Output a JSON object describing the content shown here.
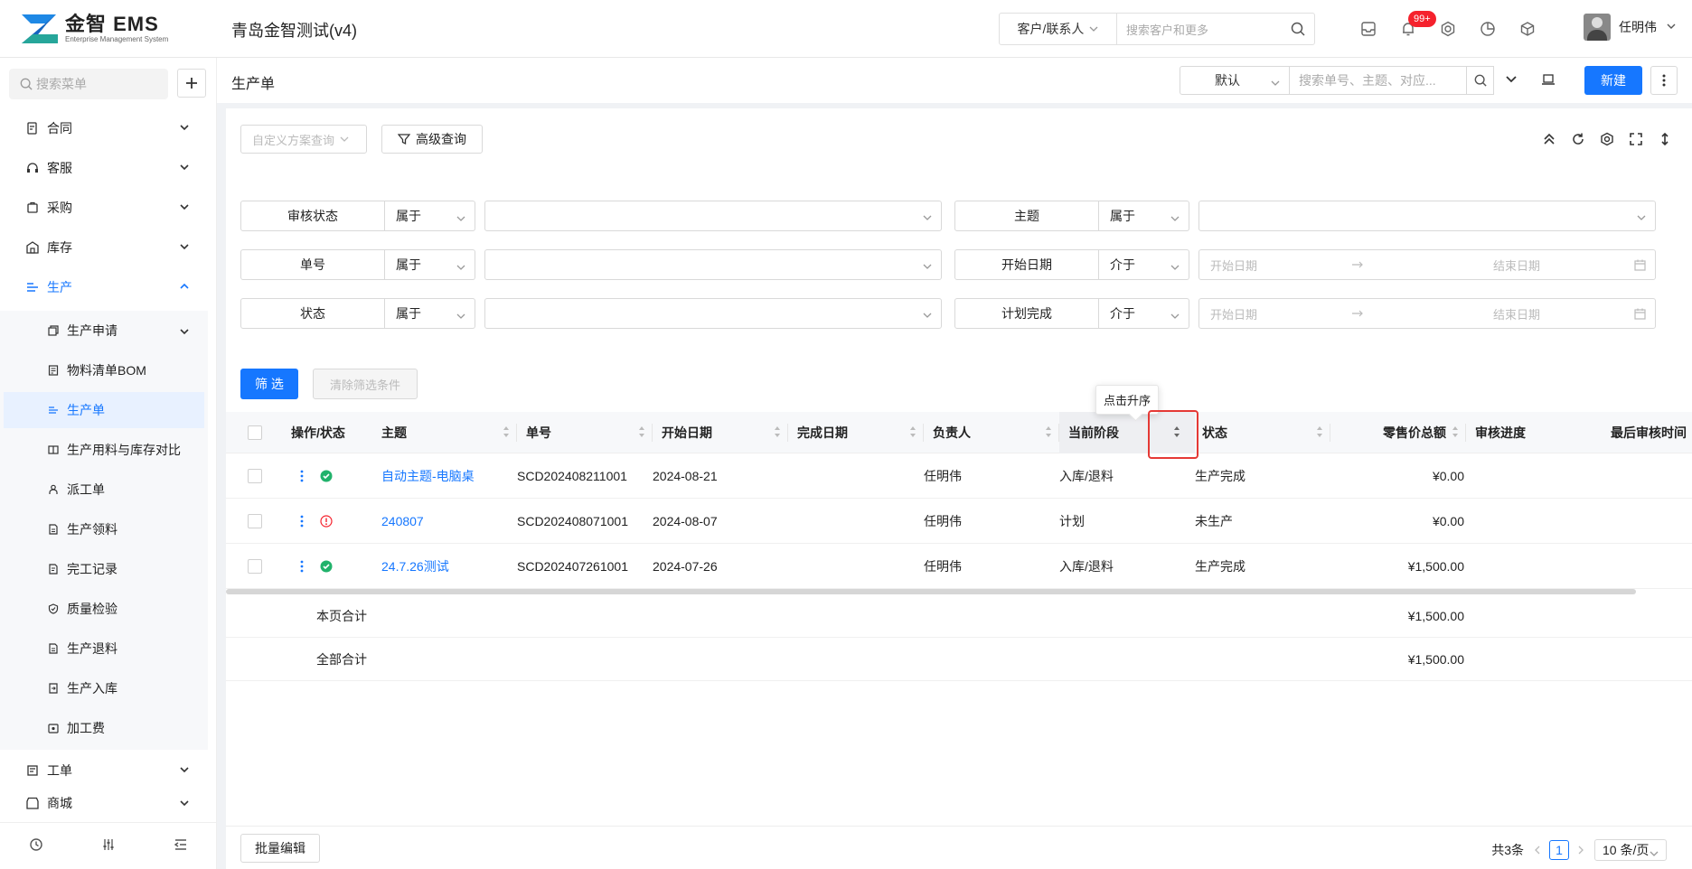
{
  "app": {
    "logo_text": "金智 EMS",
    "logo_sub": "Enterprise Management System",
    "title": "青岛金智测试(v4)"
  },
  "topbar": {
    "search_scope": "客户/联系人",
    "search_placeholder": "搜索客户和更多",
    "notification_badge": "99+",
    "user_name": "任明伟"
  },
  "sidebar": {
    "search_placeholder": "搜索菜单",
    "items": [
      {
        "label": "合同",
        "icon": "contract-icon"
      },
      {
        "label": "客服",
        "icon": "headset-icon"
      },
      {
        "label": "采购",
        "icon": "cart-icon"
      },
      {
        "label": "库存",
        "icon": "warehouse-icon"
      },
      {
        "label": "生产",
        "icon": "production-icon"
      },
      {
        "label": "工单",
        "icon": "workorder-icon"
      },
      {
        "label": "商城",
        "icon": "shop-icon"
      }
    ],
    "sub_items": [
      {
        "label": "生产申请"
      },
      {
        "label": "物料清单BOM"
      },
      {
        "label": "生产单"
      },
      {
        "label": "生产用料与库存对比"
      },
      {
        "label": "派工单"
      },
      {
        "label": "生产领料"
      },
      {
        "label": "完工记录"
      },
      {
        "label": "质量检验"
      },
      {
        "label": "生产退料"
      },
      {
        "label": "生产入库"
      },
      {
        "label": "加工费"
      }
    ]
  },
  "page": {
    "title": "生产单",
    "view_select": "默认",
    "search_placeholder": "搜索单号、主题、对应...",
    "new_button": "新建",
    "custom_query_placeholder": "自定义方案查询",
    "advanced_query": "高级查询"
  },
  "filters": [
    {
      "label": "审核状态",
      "op": "属于",
      "type": "select"
    },
    {
      "label": "主题",
      "op": "属于",
      "type": "select"
    },
    {
      "label": "单号",
      "op": "属于",
      "type": "select"
    },
    {
      "label": "开始日期",
      "op": "介于",
      "type": "date",
      "start_placeholder": "开始日期",
      "end_placeholder": "结束日期"
    },
    {
      "label": "状态",
      "op": "属于",
      "type": "select"
    },
    {
      "label": "计划完成",
      "op": "介于",
      "type": "date",
      "start_placeholder": "开始日期",
      "end_placeholder": "结束日期"
    }
  ],
  "filter_actions": {
    "apply": "筛 选",
    "clear": "清除筛选条件"
  },
  "table": {
    "columns": [
      "操作/状态",
      "主题",
      "单号",
      "开始日期",
      "完成日期",
      "负责人",
      "当前阶段",
      "状态",
      "零售价总额",
      "审核进度",
      "最后审核时间"
    ],
    "rows": [
      {
        "status": "ok",
        "subject": "自动主题-电脑桌",
        "no": "SCD202408211001",
        "start": "2024-08-21",
        "end": "",
        "owner": "任明伟",
        "stage": "入库/退料",
        "state": "生产完成",
        "amount": "¥0.00"
      },
      {
        "status": "warn",
        "subject": "240807",
        "no": "SCD202408071001",
        "start": "2024-08-07",
        "end": "",
        "owner": "任明伟",
        "stage": "计划",
        "state": "未生产",
        "amount": "¥0.00"
      },
      {
        "status": "ok",
        "subject": "24.7.26测试",
        "no": "SCD202407261001",
        "start": "2024-07-26",
        "end": "",
        "owner": "任明伟",
        "stage": "入库/退料",
        "state": "生产完成",
        "amount": "¥1,500.00"
      }
    ],
    "page_total_label": "本页合计",
    "page_total": "¥1,500.00",
    "all_total_label": "全部合计",
    "all_total": "¥1,500.00",
    "sort_tooltip": "点击升序"
  },
  "footer": {
    "batch_edit": "批量编辑",
    "total": "共3条",
    "current_page": "1",
    "page_size": "10 条/页"
  },
  "colors": {
    "primary": "#1677ff",
    "success": "#21b26b",
    "danger": "#f5222d",
    "highlight": "#e53935"
  }
}
